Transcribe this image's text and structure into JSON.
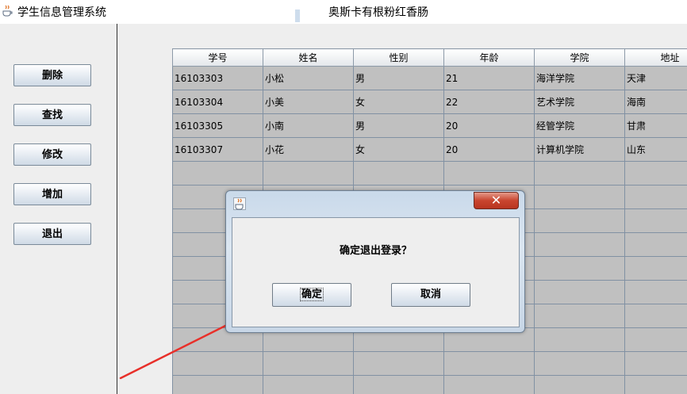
{
  "window": {
    "title": "学生信息管理系统",
    "heading": "奥斯卡有根粉红香肠",
    "icon": "java-cup-icon"
  },
  "sidebar": {
    "buttons": [
      {
        "label": "删除"
      },
      {
        "label": "查找"
      },
      {
        "label": "修改"
      },
      {
        "label": "增加"
      },
      {
        "label": "退出"
      }
    ]
  },
  "table": {
    "columns": [
      "学号",
      "姓名",
      "性别",
      "年龄",
      "学院",
      "地址"
    ],
    "rows": [
      [
        "16103303",
        "小松",
        "男",
        "21",
        "海洋学院",
        "天津"
      ],
      [
        "16103304",
        "小美",
        "女",
        "22",
        "艺术学院",
        "海南"
      ],
      [
        "16103305",
        "小南",
        "男",
        "20",
        "经管学院",
        "甘肃"
      ],
      [
        "16103307",
        "小花",
        "女",
        "20",
        "计算机学院",
        "山东"
      ]
    ]
  },
  "dialog": {
    "icon": "java-cup-icon",
    "close_glyph": "✕",
    "message": "确定退出登录？",
    "ok_label": "确定",
    "cancel_label": "取消"
  },
  "annotation": {
    "color": "#e8302a",
    "icon": "red-arrow"
  }
}
